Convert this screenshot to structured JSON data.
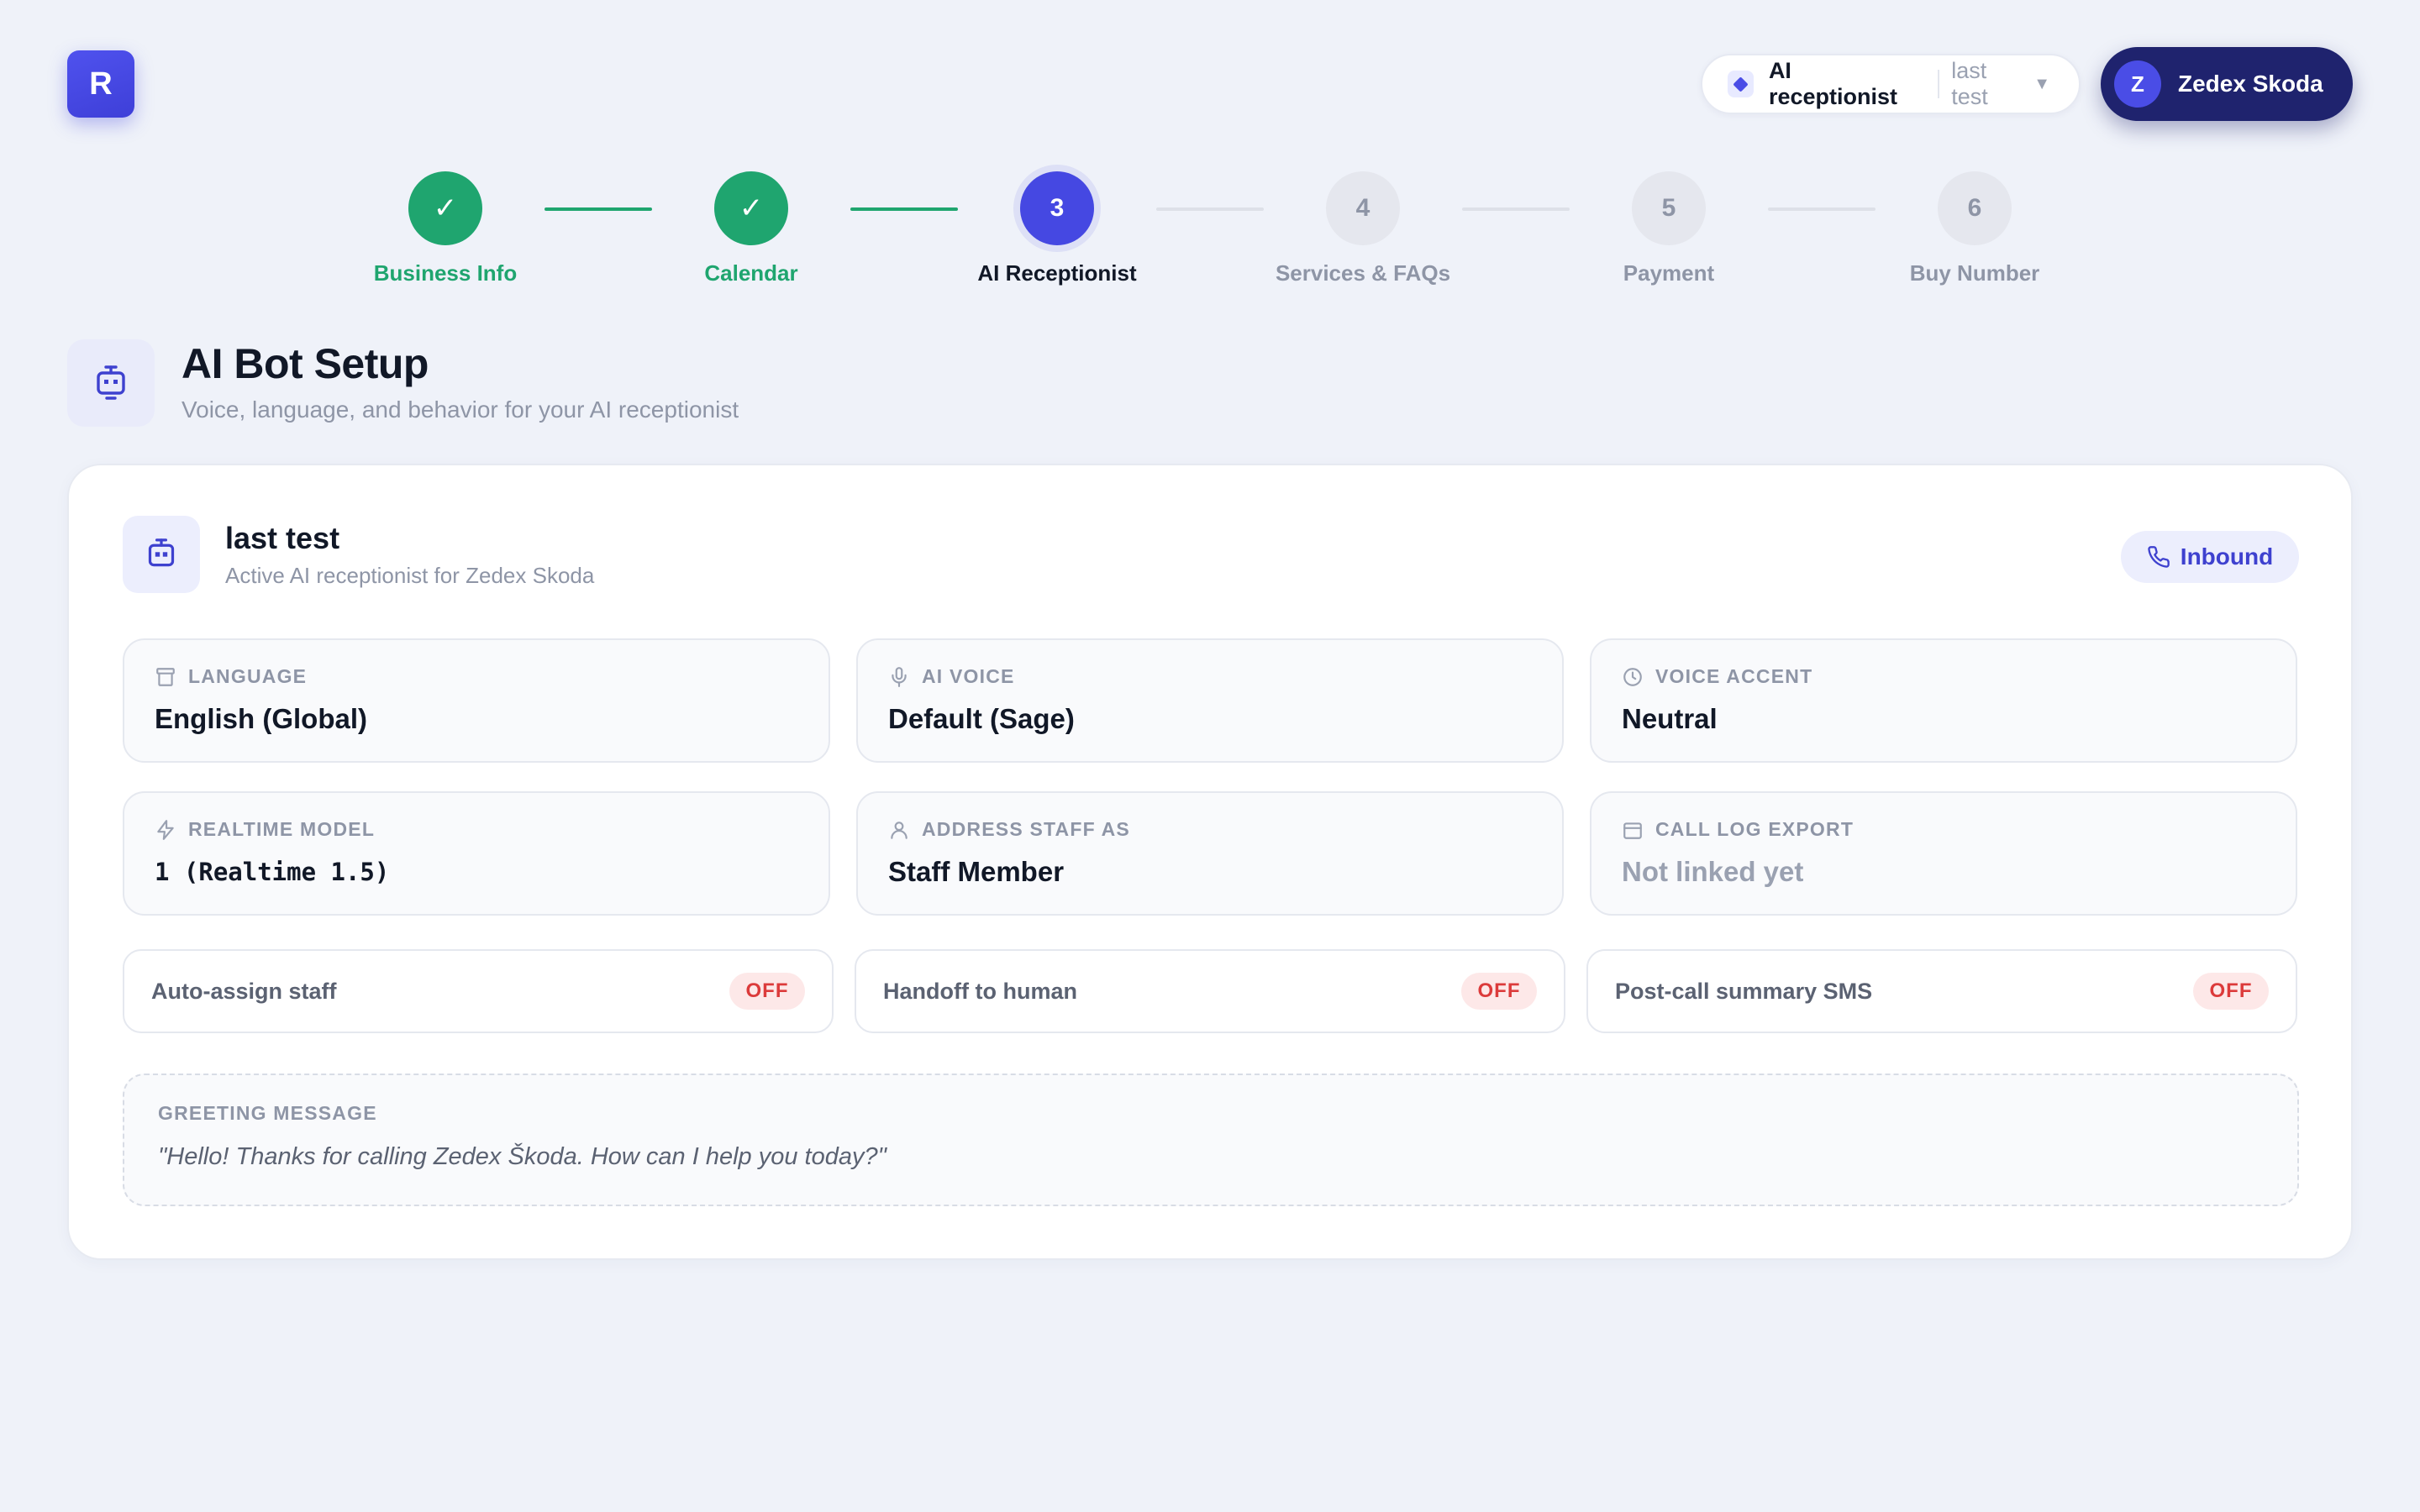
{
  "app": {
    "logo_letter": "R"
  },
  "header": {
    "agent_label": "AI receptionist",
    "agent_selected": "last test",
    "user_initial": "Z",
    "user_name": "Zedex Skoda"
  },
  "stepper": {
    "steps": [
      {
        "number": "1",
        "label": "Business Info",
        "status": "done"
      },
      {
        "number": "2",
        "label": "Calendar",
        "status": "done"
      },
      {
        "number": "3",
        "label": "AI Receptionist",
        "status": "active"
      },
      {
        "number": "4",
        "label": "Services & FAQs",
        "status": "todo"
      },
      {
        "number": "5",
        "label": "Payment",
        "status": "todo"
      },
      {
        "number": "6",
        "label": "Buy Number",
        "status": "todo"
      }
    ],
    "done_glyph": "✓"
  },
  "page": {
    "title": "AI Bot Setup",
    "subtitle": "Voice, language, and behavior for your AI receptionist"
  },
  "bot": {
    "name": "last test",
    "description": "Active AI receptionist for Zedex Skoda",
    "direction_badge": "Inbound"
  },
  "settings": [
    {
      "label": "LANGUAGE",
      "value": "English (Global)",
      "icon": "archive-icon"
    },
    {
      "label": "AI VOICE",
      "value": "Default (Sage)",
      "icon": "microphone-icon"
    },
    {
      "label": "VOICE ACCENT",
      "value": "Neutral",
      "icon": "clock-icon"
    },
    {
      "label": "REALTIME MODEL",
      "value": "1 (Realtime 1.5)",
      "icon": "lightning-icon"
    },
    {
      "label": "ADDRESS STAFF AS",
      "value": "Staff Member",
      "icon": "user-icon"
    },
    {
      "label": "CALL LOG EXPORT",
      "value": "Not linked yet",
      "icon": "calendar-icon"
    }
  ],
  "toggles": [
    {
      "label": "Auto-assign staff",
      "state": "OFF"
    },
    {
      "label": "Handoff to human",
      "state": "OFF"
    },
    {
      "label": "Post-call summary SMS",
      "state": "OFF"
    }
  ],
  "greeting": {
    "label": "GREETING MESSAGE",
    "text": "\"Hello! Thanks for calling Zedex Škoda. How can I help you today?\""
  },
  "colors": {
    "accent": "#4548e2",
    "success": "#1fa56f",
    "navy": "#1f236e",
    "off_badge_text": "#dc3b3b",
    "off_badge_bg": "#fde8e8",
    "background": "#eff2f9"
  }
}
